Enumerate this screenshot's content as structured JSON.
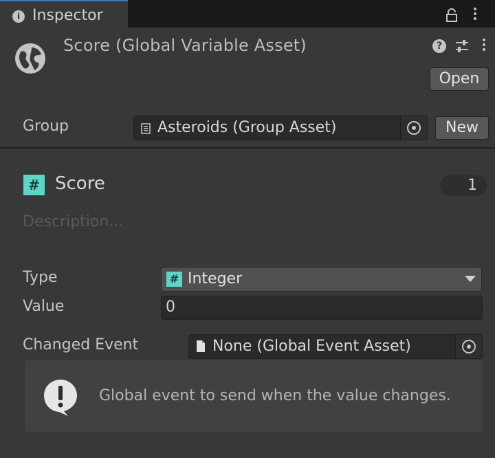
{
  "tab": {
    "title": "Inspector",
    "icon": "info-icon"
  },
  "header": {
    "title": "Score (Global Variable Asset)",
    "icon": "globe-icon",
    "open_button": "Open"
  },
  "group": {
    "label": "Group",
    "value": "Asteroids (Group Asset)",
    "new_button": "New"
  },
  "variable": {
    "badge": "#",
    "name": "Score",
    "count": "1",
    "description_placeholder": "Description..."
  },
  "fields": {
    "type_label": "Type",
    "type_badge": "#",
    "type_value": "Integer",
    "value_label": "Value",
    "value": "0",
    "changed_event_label": "Changed Event",
    "changed_event_value": "None (Global Event Asset)"
  },
  "help": {
    "text": "Global event to send when the value changes.",
    "icon": "warning-bubble-icon"
  },
  "colors": {
    "background": "#383838",
    "tab_accent": "#3a79bb",
    "integer_badge": "#5cd6c6"
  }
}
